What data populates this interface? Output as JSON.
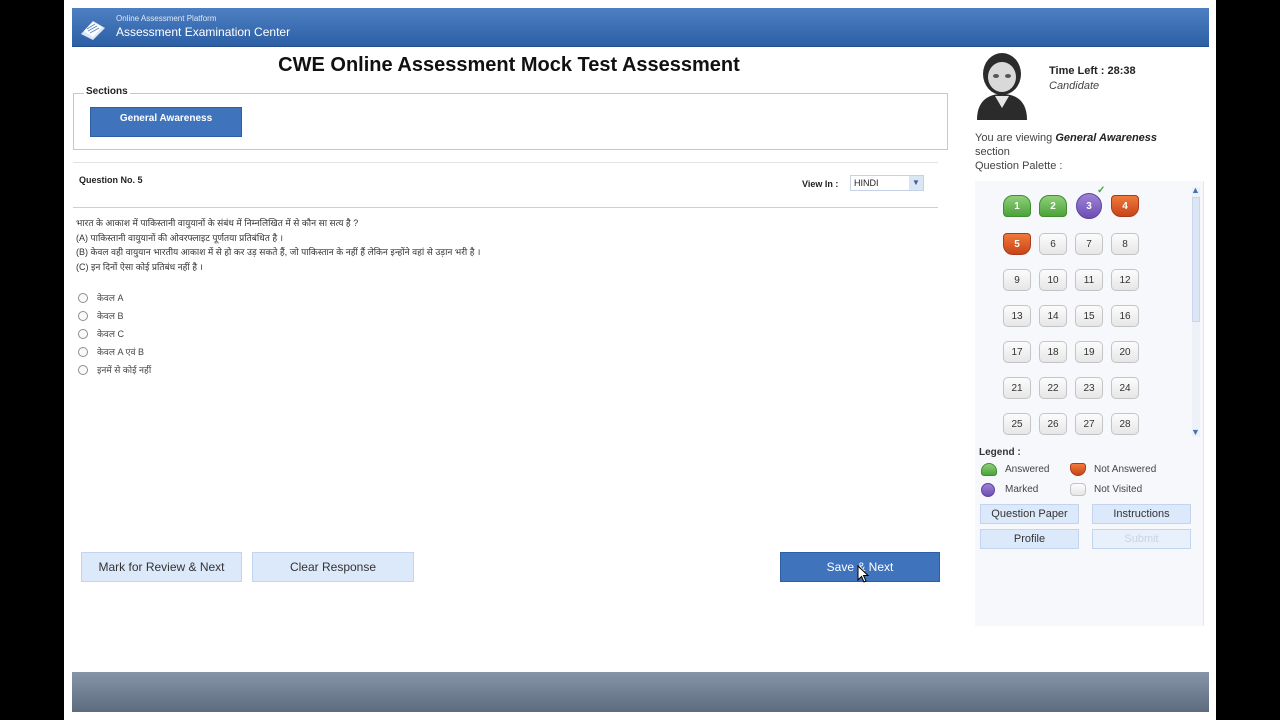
{
  "header": {
    "brand_small": "Online Assessment Platform",
    "brand_title": "Assessment Examination Center"
  },
  "exam": {
    "title": "CWE Online Assessment Mock Test Assessment",
    "sections_label": "Sections",
    "section_tab": "General Awareness"
  },
  "question": {
    "number_label": "Question No. 5",
    "view_in_label": "View In :",
    "language": "HINDI",
    "text_lines": [
      "भारत के आकाश में पाकिस्तानी वायुयानों के संबंध में निम्नलिखित में से कौन सा सत्य है ?",
      "(A) पाकिस्तानी वायुयानों की ओवरफ्लाइट पूर्णतया प्रतिबंधित है ।",
      "(B) केवल वही वायुयान भारतीय आकाश में से हो कर उड़ सकते हैं, जो पाकिस्तान के नहीं हैं लेकिन इन्होंने वहां से उड़ान भरी है ।",
      "(C) इन दिनों ऐसा कोई प्रतिबंध नहीं है ।"
    ],
    "options": [
      "केवल A",
      "केवल B",
      "केवल C",
      "केवल A एवं B",
      "इनमें से कोई नहीं"
    ]
  },
  "actions": {
    "mark_review": "Mark for Review & Next",
    "clear_response": "Clear Response",
    "save_next": "Save & Next"
  },
  "candidate": {
    "time_left": "Time Left : 28:38",
    "name": "Candidate",
    "viewing_prefix": "You are viewing",
    "viewing_section": "General Awareness",
    "viewing_suffix": "section",
    "palette_label": "Question Palette :"
  },
  "palette": [
    {
      "n": "1",
      "status": "answered"
    },
    {
      "n": "2",
      "status": "answered"
    },
    {
      "n": "3",
      "status": "marked"
    },
    {
      "n": "4",
      "status": "not-answered"
    },
    {
      "n": "5",
      "status": "not-answered"
    },
    {
      "n": "6",
      "status": "not-visited"
    },
    {
      "n": "7",
      "status": "not-visited"
    },
    {
      "n": "8",
      "status": "not-visited"
    },
    {
      "n": "9",
      "status": "not-visited"
    },
    {
      "n": "10",
      "status": "not-visited"
    },
    {
      "n": "11",
      "status": "not-visited"
    },
    {
      "n": "12",
      "status": "not-visited"
    },
    {
      "n": "13",
      "status": "not-visited"
    },
    {
      "n": "14",
      "status": "not-visited"
    },
    {
      "n": "15",
      "status": "not-visited"
    },
    {
      "n": "16",
      "status": "not-visited"
    },
    {
      "n": "17",
      "status": "not-visited"
    },
    {
      "n": "18",
      "status": "not-visited"
    },
    {
      "n": "19",
      "status": "not-visited"
    },
    {
      "n": "20",
      "status": "not-visited"
    },
    {
      "n": "21",
      "status": "not-visited"
    },
    {
      "n": "22",
      "status": "not-visited"
    },
    {
      "n": "23",
      "status": "not-visited"
    },
    {
      "n": "24",
      "status": "not-visited"
    },
    {
      "n": "25",
      "status": "not-visited"
    },
    {
      "n": "26",
      "status": "not-visited"
    },
    {
      "n": "27",
      "status": "not-visited"
    },
    {
      "n": "28",
      "status": "not-visited"
    }
  ],
  "legend": {
    "title": "Legend :",
    "answered": "Answered",
    "not_answered": "Not Answered",
    "marked": "Marked",
    "not_visited": "Not Visited"
  },
  "panel_buttons": {
    "question_paper": "Question Paper",
    "instructions": "Instructions",
    "profile": "Profile",
    "submit": "Submit"
  },
  "colors": {
    "header_blue": "#3f74bd",
    "answered": "#4ca23a",
    "not_answered": "#c8441a",
    "marked": "#6d4fb3"
  }
}
